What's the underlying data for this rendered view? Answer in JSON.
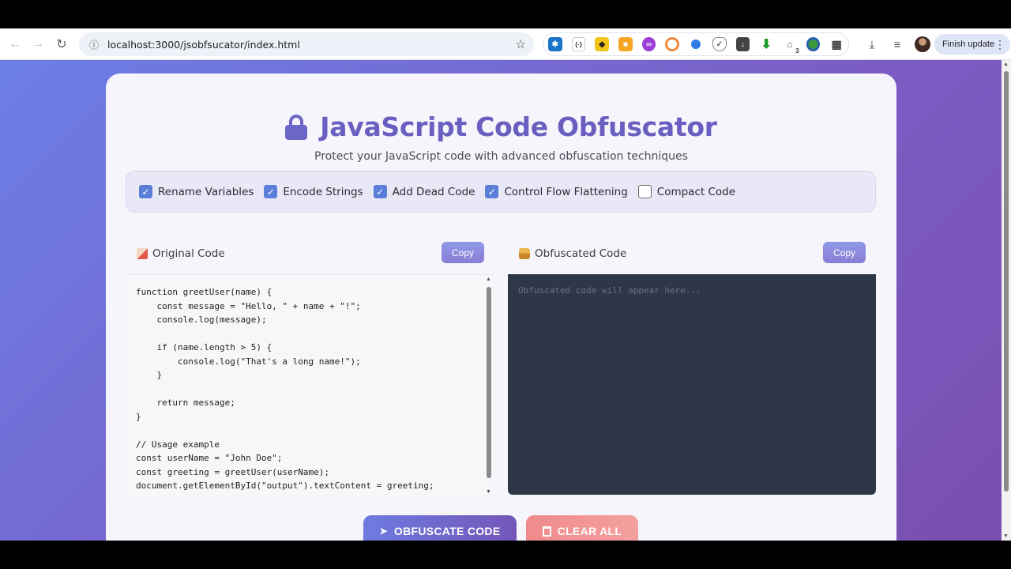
{
  "browser": {
    "url": "localhost:3000/jsobfsucator/index.html",
    "finish_update": "Finish update",
    "extension_badge": "3"
  },
  "header": {
    "title": "JavaScript Code Obfuscator",
    "subtitle": "Protect your JavaScript code with advanced obfuscation techniques"
  },
  "options": [
    {
      "label": "Rename Variables",
      "checked": true
    },
    {
      "label": "Encode Strings",
      "checked": true
    },
    {
      "label": "Add Dead Code",
      "checked": true
    },
    {
      "label": "Control Flow Flattening",
      "checked": true
    },
    {
      "label": "Compact Code",
      "checked": false
    }
  ],
  "original": {
    "label": "Original Code",
    "copy_label": "Copy",
    "code": "function greetUser(name) {\n    const message = \"Hello, \" + name + \"!\";\n    console.log(message);\n\n    if (name.length > 5) {\n        console.log(\"That's a long name!\");\n    }\n\n    return message;\n}\n\n// Usage example\nconst userName = \"John Doe\";\nconst greeting = greetUser(userName);\ndocument.getElementById(\"output\").textContent = greeting;"
  },
  "obfuscated": {
    "label": "Obfuscated Code",
    "copy_label": "Copy",
    "placeholder": "Obfuscated code will appear here..."
  },
  "actions": {
    "obfuscate_label": "OBFUSCATE CODE",
    "clear_label": "CLEAR ALL"
  }
}
